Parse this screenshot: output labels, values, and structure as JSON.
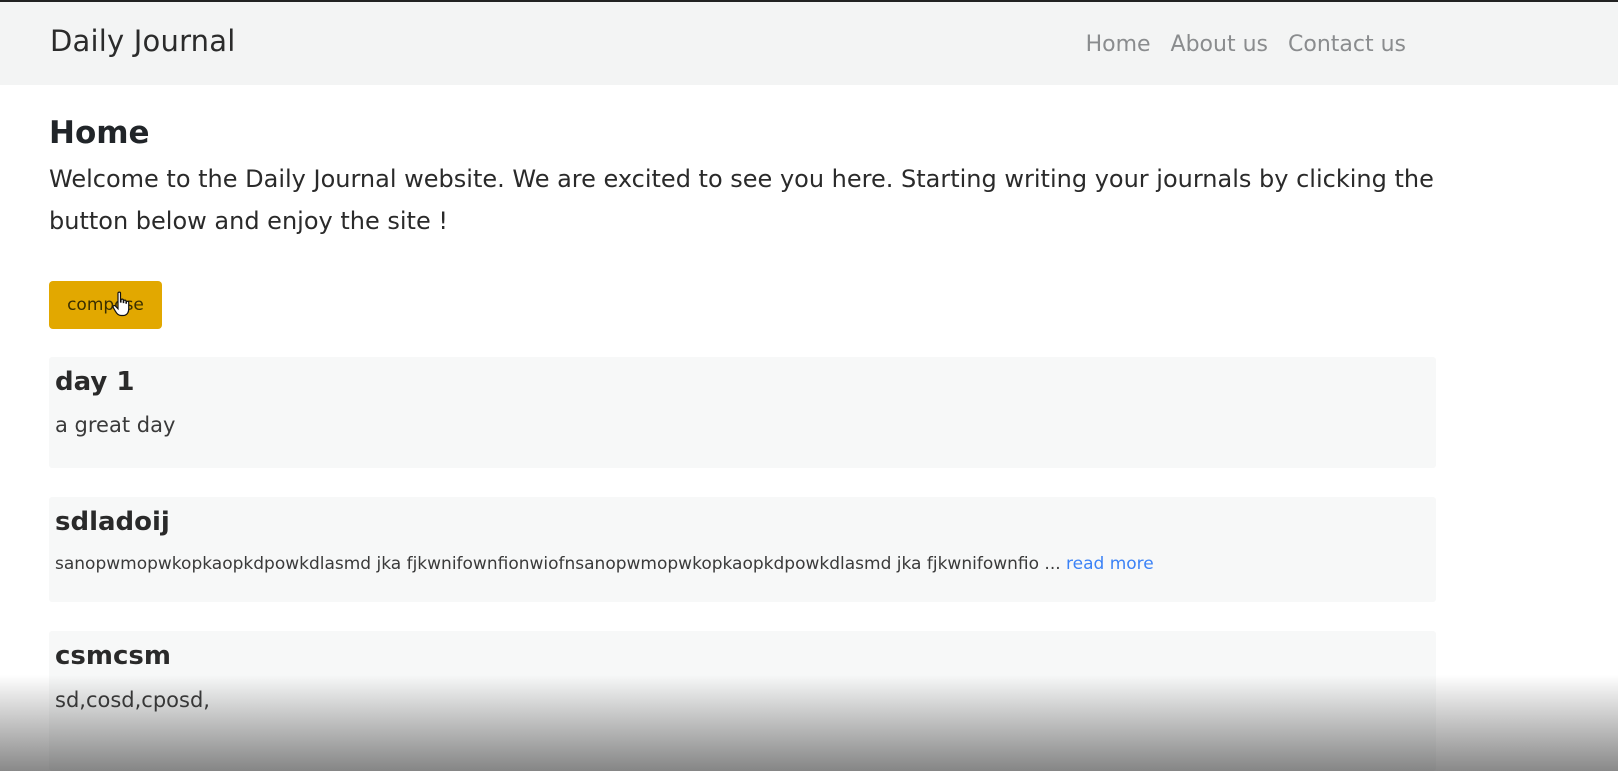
{
  "header": {
    "brand": "Daily Journal",
    "nav": [
      "Home",
      "About us",
      "Contact us"
    ]
  },
  "main": {
    "title": "Home",
    "intro": "Welcome to the Daily Journal website. We are excited to see you here. Starting writing your journals by clicking the button below and enjoy the site !",
    "compose_label": "compose"
  },
  "posts": [
    {
      "title": "day 1",
      "body": "a great day"
    },
    {
      "title": "sdladoij",
      "body": "sanopwmopwkopkaopkdpowkdlasmd jka fjkwnifownfionwiofnsanopwmopwkopkaopkdpowkdlasmd jka fjkwnifownfio ...",
      "link": "read more"
    },
    {
      "title": "csmcsm",
      "body": "sd,cosd,cposd,"
    }
  ],
  "colors": {
    "accent": "#e2a800",
    "link": "#3b82f6",
    "navbar": "#f3f4f4"
  },
  "icons": [
    "hand-pointer-cursor-icon"
  ]
}
